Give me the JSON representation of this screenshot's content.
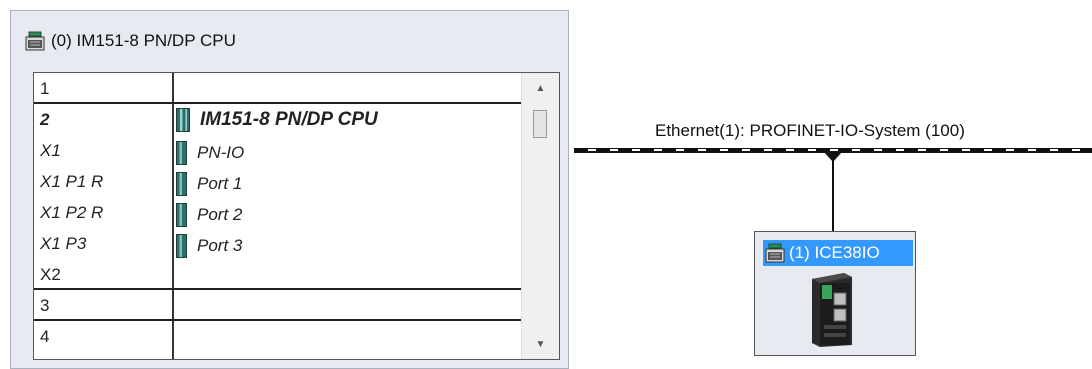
{
  "rack": {
    "title": "(0) IM151-8 PN/DP CPU",
    "title_icon": "station-icon",
    "rows": [
      {
        "slot": "1",
        "module": "",
        "style": "plain"
      },
      {
        "slot": "2",
        "module": "IM151-8 PN/DP CPU",
        "style": "bold"
      },
      {
        "slot": "X1",
        "module": "PN-IO",
        "style": "italic"
      },
      {
        "slot": "X1 P1 R",
        "module": "Port 1",
        "style": "italic"
      },
      {
        "slot": "X1 P2 R",
        "module": "Port 2",
        "style": "italic"
      },
      {
        "slot": "X1 P3",
        "module": "Port 3",
        "style": "italic"
      },
      {
        "slot": "X2",
        "module": "",
        "style": "plain"
      },
      {
        "slot": "3",
        "module": "",
        "style": "plain"
      },
      {
        "slot": "4",
        "module": "",
        "style": "plain"
      }
    ]
  },
  "network": {
    "label": "Ethernet(1): PROFINET-IO-System (100)",
    "color": "#111111"
  },
  "device": {
    "title": "(1) ICE38IO",
    "title_icon": "station-icon",
    "selected_color": "#3399ff"
  }
}
